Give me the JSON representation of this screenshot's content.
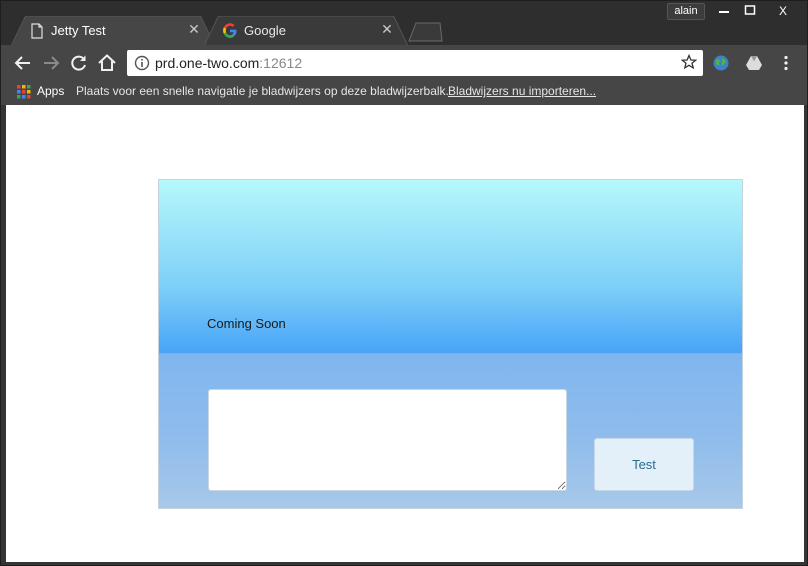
{
  "window": {
    "user": "alain",
    "controls": {
      "minimize": "—",
      "maximize": "☐",
      "close": "X"
    }
  },
  "tabs": [
    {
      "title": "Jetty Test",
      "icon": "document-icon",
      "active": true
    },
    {
      "title": "Google",
      "icon": "google-icon",
      "active": false
    }
  ],
  "toolbar": {
    "url_host": "prd.one-two.com",
    "url_port": ":12612",
    "extensions": [
      "globe-extension-icon",
      "drive-icon"
    ]
  },
  "bookmarks": {
    "apps_label": "Apps",
    "hint": "Plaats voor een snelle navigatie je bladwijzers op deze bladwijzerbalk.",
    "import_link": "Bladwijzers nu importeren..."
  },
  "page": {
    "heading": "Coming Soon",
    "textbox_value": "",
    "button_label": "Test"
  },
  "colors": {
    "panel_top": "#b6f8fb",
    "panel_mid": "#4aa5f8",
    "panel_bottom": "#a8c8e8",
    "button_text": "#2c6a8c"
  }
}
